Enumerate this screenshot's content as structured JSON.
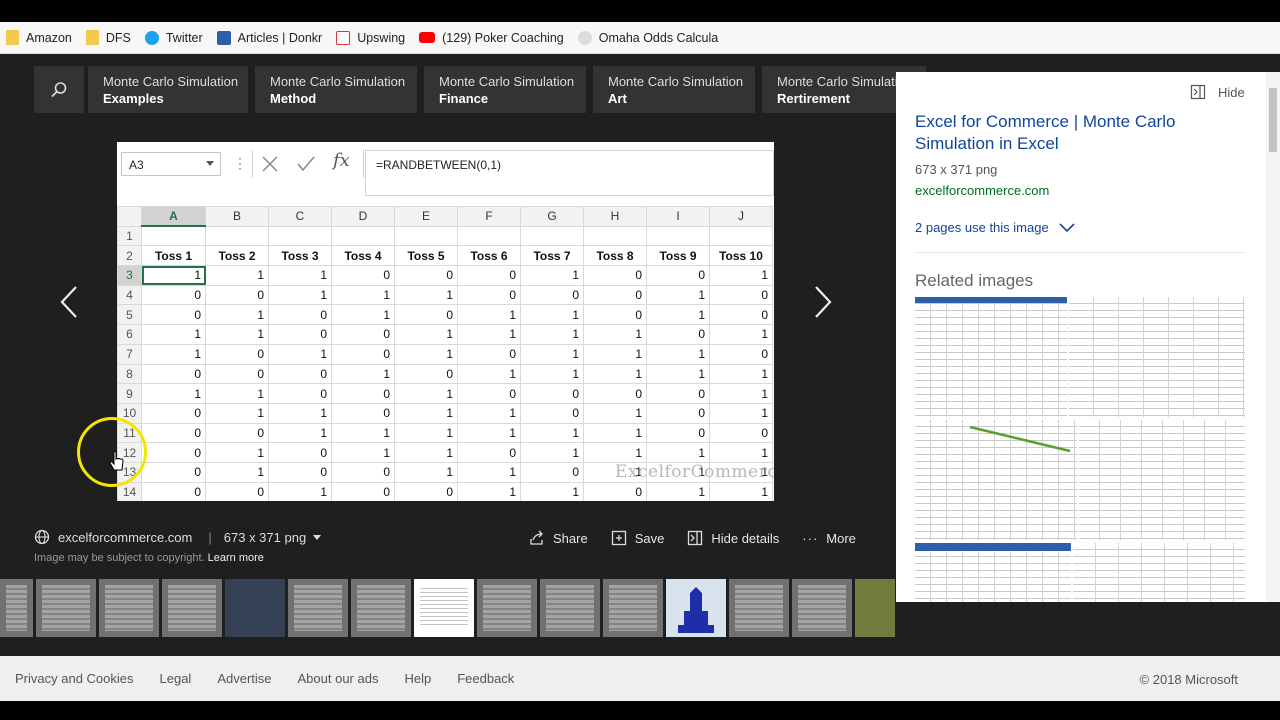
{
  "bookmarks": [
    {
      "label": "Amazon",
      "icon": "folder-icon"
    },
    {
      "label": "DFS",
      "icon": "folder-icon"
    },
    {
      "label": "Twitter",
      "icon": "twitter-icon"
    },
    {
      "label": "Articles | Donkr",
      "icon": "donkr-icon"
    },
    {
      "label": "Upswing",
      "icon": "upswing-icon"
    },
    {
      "label": "(129) Poker Coaching",
      "icon": "youtube-icon"
    },
    {
      "label": "Omaha Odds Calcula",
      "icon": "omaha-icon"
    }
  ],
  "related_searches": [
    {
      "line1": "Monte Carlo Simulation",
      "line2": "Examples"
    },
    {
      "line1": "Monte Carlo Simulation",
      "line2": "Method"
    },
    {
      "line1": "Monte Carlo Simulation",
      "line2": "Finance"
    },
    {
      "line1": "Monte Carlo Simulation",
      "line2": "Art"
    },
    {
      "line1": "Monte Carlo Simulation",
      "line2": "Rertirement"
    }
  ],
  "excel": {
    "name_box": "A3",
    "formula": "=RANDBETWEEN(0,1)",
    "columns": [
      "A",
      "B",
      "C",
      "D",
      "E",
      "F",
      "G",
      "H",
      "I",
      "J"
    ],
    "row_numbers": [
      "1",
      "2",
      "3",
      "4",
      "5",
      "6",
      "7",
      "8",
      "9",
      "10",
      "11",
      "12",
      "13",
      "14"
    ],
    "headers": [
      "Toss 1",
      "Toss 2",
      "Toss 3",
      "Toss 4",
      "Toss 5",
      "Toss 6",
      "Toss 7",
      "Toss 8",
      "Toss 9",
      "Toss 10"
    ],
    "rows": [
      [
        "1",
        "1",
        "1",
        "0",
        "0",
        "0",
        "1",
        "0",
        "0",
        "1"
      ],
      [
        "0",
        "0",
        "1",
        "1",
        "1",
        "0",
        "0",
        "0",
        "1",
        "0"
      ],
      [
        "0",
        "1",
        "0",
        "1",
        "0",
        "1",
        "1",
        "0",
        "1",
        "0"
      ],
      [
        "1",
        "1",
        "0",
        "0",
        "1",
        "1",
        "1",
        "1",
        "0",
        "1"
      ],
      [
        "1",
        "0",
        "1",
        "0",
        "1",
        "0",
        "1",
        "1",
        "1",
        "0"
      ],
      [
        "0",
        "0",
        "0",
        "1",
        "0",
        "1",
        "1",
        "1",
        "1",
        "1"
      ],
      [
        "1",
        "1",
        "0",
        "0",
        "1",
        "0",
        "0",
        "0",
        "0",
        "1"
      ],
      [
        "0",
        "1",
        "1",
        "0",
        "1",
        "1",
        "0",
        "1",
        "0",
        "1"
      ],
      [
        "0",
        "0",
        "1",
        "1",
        "1",
        "1",
        "1",
        "1",
        "0",
        "0"
      ],
      [
        "0",
        "1",
        "0",
        "1",
        "1",
        "0",
        "1",
        "1",
        "1",
        "1"
      ],
      [
        "0",
        "1",
        "0",
        "0",
        "1",
        "1",
        "0",
        "1",
        "1",
        "1"
      ],
      [
        "0",
        "0",
        "1",
        "0",
        "0",
        "1",
        "1",
        "0",
        "1",
        "1"
      ]
    ],
    "watermark": "ExcelforCommerce"
  },
  "image_info": {
    "source": "excelforcommerce.com",
    "size": "673 x 371 png",
    "copyright": "Image may be subject to copyright.",
    "learn_more": "Learn more"
  },
  "actions": {
    "share": "Share",
    "save": "Save",
    "hide_details": "Hide details",
    "more": "More"
  },
  "details": {
    "hide_label": "Hide",
    "title": "Excel for Commerce | Monte Carlo Simulation in Excel",
    "meta": "673 x 371 png",
    "domain": "excelforcommerce.com",
    "pages": "2 pages use this image",
    "related_heading": "Related images"
  },
  "footer": {
    "links": [
      "Privacy and Cookies",
      "Legal",
      "Advertise",
      "About our ads",
      "Help",
      "Feedback"
    ],
    "copyright": "© 2018 Microsoft"
  },
  "colors": {
    "link": "#12449a",
    "domain_green": "#006d21",
    "excel_green": "#217346",
    "cursor_highlight": "#f3e600"
  }
}
